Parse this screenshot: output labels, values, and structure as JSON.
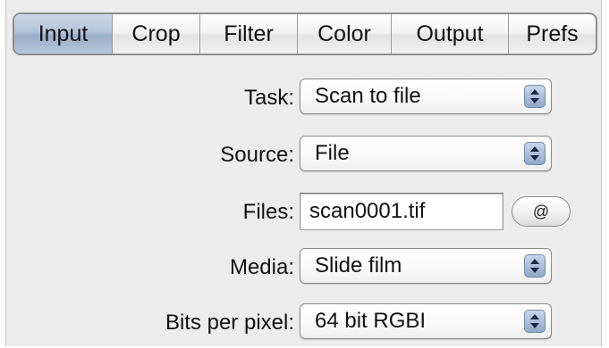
{
  "tabs": [
    {
      "label": "Input",
      "active": true
    },
    {
      "label": "Crop",
      "active": false
    },
    {
      "label": "Filter",
      "active": false
    },
    {
      "label": "Color",
      "active": false
    },
    {
      "label": "Output",
      "active": false
    },
    {
      "label": "Prefs",
      "active": false
    }
  ],
  "task": {
    "label": "Task:",
    "value": "Scan to file"
  },
  "source": {
    "label": "Source:",
    "value": "File"
  },
  "files": {
    "label": "Files:",
    "value": "scan0001.tif",
    "button": "@"
  },
  "media": {
    "label": "Media:",
    "value": "Slide film"
  },
  "bits": {
    "label": "Bits per pixel:",
    "value": "64 bit RGBI"
  },
  "colors": {
    "active_tab": "#b4c5da",
    "panel": "#ececec"
  }
}
